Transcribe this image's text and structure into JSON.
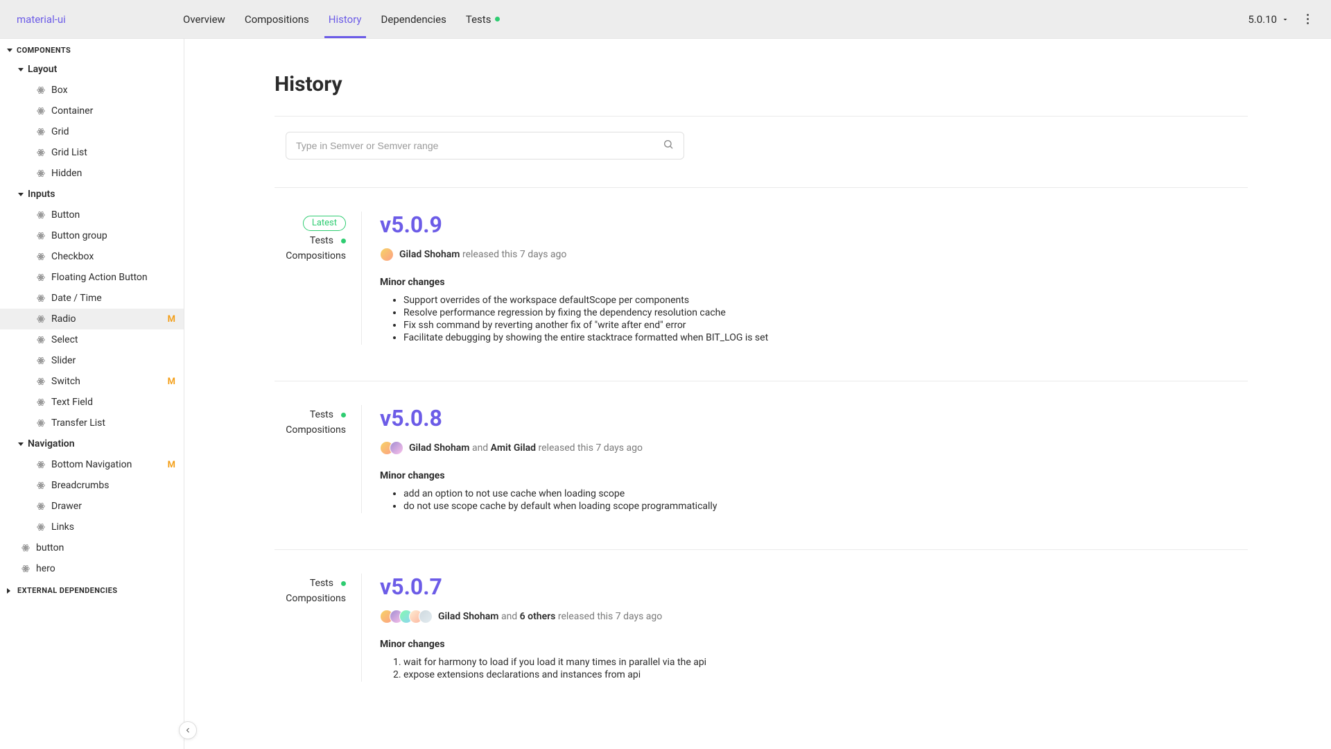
{
  "brand": "material-ui",
  "tabs": [
    {
      "label": "Overview",
      "active": false,
      "dot": false
    },
    {
      "label": "Compositions",
      "active": false,
      "dot": false
    },
    {
      "label": "History",
      "active": true,
      "dot": false
    },
    {
      "label": "Dependencies",
      "active": false,
      "dot": false
    },
    {
      "label": "Tests",
      "active": false,
      "dot": true
    }
  ],
  "top_version": "5.0.10",
  "sidebar": {
    "section_components": "Components",
    "section_external": "External Dependencies",
    "groups": {
      "layout": {
        "label": "Layout",
        "items": [
          {
            "label": "Box"
          },
          {
            "label": "Container"
          },
          {
            "label": "Grid"
          },
          {
            "label": "Grid List"
          },
          {
            "label": "Hidden"
          }
        ]
      },
      "inputs": {
        "label": "Inputs",
        "items": [
          {
            "label": "Button"
          },
          {
            "label": "Button group"
          },
          {
            "label": "Checkbox"
          },
          {
            "label": "Floating Action Button"
          },
          {
            "label": "Date / Time"
          },
          {
            "label": "Radio",
            "selected": true,
            "modified": true
          },
          {
            "label": "Select"
          },
          {
            "label": "Slider"
          },
          {
            "label": "Switch",
            "modified": true
          },
          {
            "label": "Text Field"
          },
          {
            "label": "Transfer List"
          }
        ]
      },
      "navigation": {
        "label": "Navigation",
        "items": [
          {
            "label": "Bottom Navigation",
            "modified": true
          },
          {
            "label": "Breadcrumbs"
          },
          {
            "label": "Drawer"
          },
          {
            "label": "Links"
          }
        ]
      }
    },
    "loose": [
      {
        "label": "button"
      },
      {
        "label": "hero"
      }
    ],
    "modified_badge": "M"
  },
  "page": {
    "title": "History",
    "search_placeholder": "Type in Semver or Semver range"
  },
  "versions": [
    {
      "tag": "v5.0.9",
      "latest_label": "Latest",
      "latest": true,
      "tests_label": "Tests",
      "compositions_label": "Compositions",
      "avatars": 1,
      "author_html": "<b>Gilad Shoham</b> released this 7 days ago",
      "section_title": "Minor changes",
      "list_type": "ul",
      "changes": [
        "Support overrides of the workspace defaultScope per components",
        "Resolve performance regression by fixing the dependency resolution cache",
        "Fix ssh command by reverting another fix of \"write after end\" error",
        "Facilitate debugging by showing the entire stacktrace formatted when BIT_LOG is set"
      ]
    },
    {
      "tag": "v5.0.8",
      "latest": false,
      "tests_label": "Tests",
      "compositions_label": "Compositions",
      "avatars": 2,
      "author_html": "<b>Gilad Shoham</b> and <b>Amit Gilad</b> released this 7 days ago",
      "section_title": "Minor changes",
      "list_type": "ul",
      "changes": [
        "add an option to not use cache when loading scope",
        "do not use scope cache by default when loading scope programmatically"
      ]
    },
    {
      "tag": "v5.0.7",
      "latest": false,
      "tests_label": "Tests",
      "compositions_label": "Compositions",
      "avatars": 5,
      "author_html": "<b>Gilad Shoham</b> and <b>6 others</b> released this 7 days ago",
      "section_title": "Minor changes",
      "list_type": "ol",
      "changes": [
        "wait for harmony to load if you load it many times in parallel via the api",
        "expose extensions declarations and instances from api"
      ]
    }
  ]
}
